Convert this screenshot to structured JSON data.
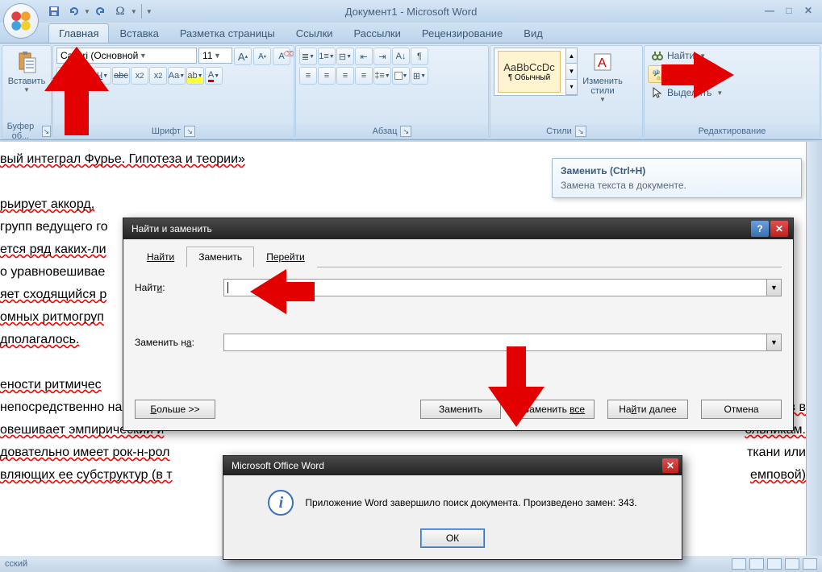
{
  "titlebar": {
    "title": "Документ1 - Microsoft Word"
  },
  "tabs": {
    "home": "Главная",
    "insert": "Вставка",
    "layout": "Разметка страницы",
    "refs": "Ссылки",
    "mail": "Рассылки",
    "review": "Рецензирование",
    "view": "Вид"
  },
  "ribbon": {
    "clipboard": {
      "paste": "Вставить",
      "label": "Буфер об..."
    },
    "font": {
      "family": "Calibri (Основной",
      "size": "11",
      "label": "Шрифт"
    },
    "paragraph": {
      "label": "Абзац"
    },
    "styles": {
      "preview": "AaBbCcDc",
      "name": "¶ Обычный",
      "change": "Изменить стили",
      "label": "Стили"
    },
    "editing": {
      "find": "Найти",
      "replace": "Заменить",
      "select": "Выделить",
      "label": "Редактирование"
    }
  },
  "tooltip": {
    "title": "Заменить (Ctrl+H)",
    "body": "Замена текста в документе."
  },
  "document_lines": [
    "вый интеграл Фурье. Гипотеза и теории»",
    "",
    "рьирует аккорд,",
    "групп ведущего го",
    "ется ряд каких-ли",
    "о уравновешивае",
    "яет сходящийся р",
    "омных ритмогруп",
    "дполагалось.",
    "",
    "ености ритмичес",
    "непосредственно накладыва",
    "овешивает эмпирический и",
    "довательно имеет рок-н-рол",
    "вляющих ее субструктур (в т"
  ],
  "doc_tail": {
    "l11": "лев в",
    "l12": "ольникам.",
    "l13": "ткани или",
    "l14": "емповой)"
  },
  "dialog": {
    "title": "Найти и заменить",
    "tabs": {
      "find": "Найти",
      "replace": "Заменить",
      "goto": "Перейти"
    },
    "find_label_pre": "Найт",
    "find_label_ul": "и",
    "find_label_post": ":",
    "replace_label_pre": "Заменить н",
    "replace_label_ul": "а",
    "replace_label_post": ":",
    "find_value": "",
    "replace_value": "",
    "buttons": {
      "more": "Больше >>",
      "replace": "Заменить",
      "replace_all_pre": "Заменить ",
      "replace_all_ul": "все",
      "find_next_pre": "На",
      "find_next_ul": "й",
      "find_next_post": "ти далее",
      "cancel": "Отмена"
    }
  },
  "msgbox": {
    "title": "Microsoft Office Word",
    "text": "Приложение Word завершило поиск документа. Произведено замен: 343.",
    "ok": "ОК"
  },
  "statusbar": {
    "lang": "сский"
  },
  "colors": {
    "accent": "#3a70c0",
    "arrow": "#e20000"
  }
}
